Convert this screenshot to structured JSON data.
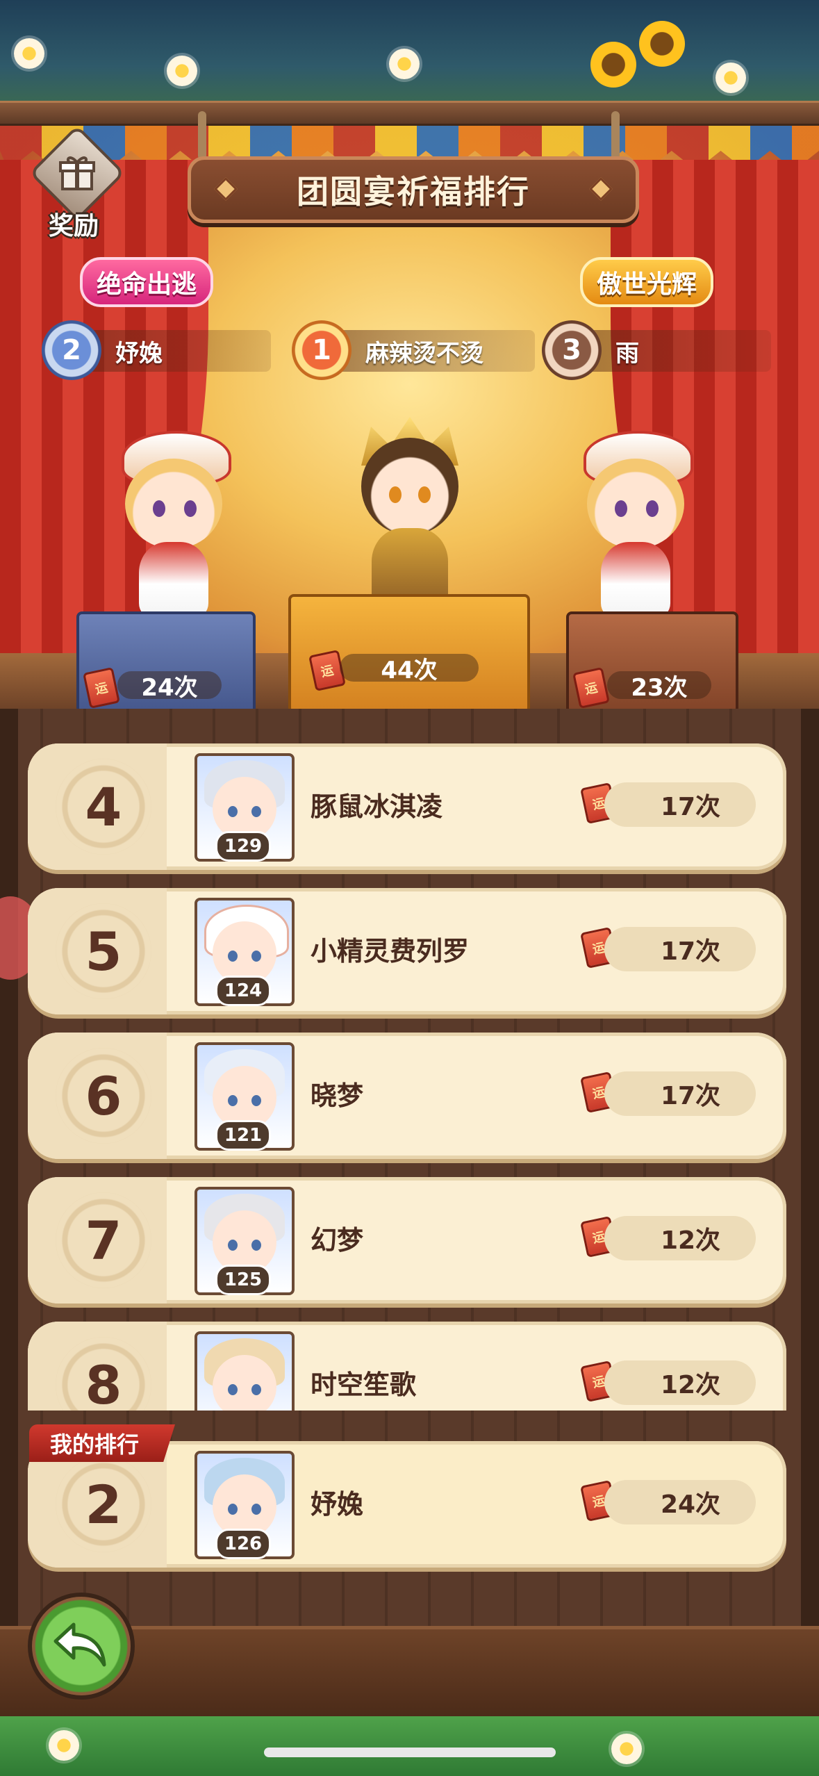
{
  "title": "团圆宴祈福排行",
  "reward_label": "奖励",
  "badges": {
    "left": "绝命出逃",
    "right": "傲世光辉"
  },
  "top3": [
    {
      "rank": "2",
      "name": "妤婏",
      "count": "24次"
    },
    {
      "rank": "1",
      "name": "麻辣烫不烫",
      "count": "44次"
    },
    {
      "rank": "3",
      "name": "雨",
      "count": "23次"
    }
  ],
  "ticket_char": "运",
  "list": [
    {
      "rank": "4",
      "name": "豚鼠冰淇凌",
      "level": "129",
      "count": "17次",
      "hair": "#dfe4ee"
    },
    {
      "rank": "5",
      "name": "小精灵费列罗",
      "level": "124",
      "count": "17次",
      "hair": "#ffffff"
    },
    {
      "rank": "6",
      "name": "晓梦",
      "level": "121",
      "count": "17次",
      "hair": "#e8eef8"
    },
    {
      "rank": "7",
      "name": "幻梦",
      "level": "125",
      "count": "12次",
      "hair": "#e6e6ea"
    },
    {
      "rank": "8",
      "name": "时空笙歌",
      "level": "",
      "count": "12次",
      "hair": "#f0d9b0"
    }
  ],
  "my_rank": {
    "label": "我的排行",
    "rank": "2",
    "name": "妤婏",
    "level": "126",
    "count": "24次"
  },
  "colors": {
    "accent": "#c8372d",
    "row_bg": "#fbefd3",
    "text": "#4a2b1f"
  }
}
